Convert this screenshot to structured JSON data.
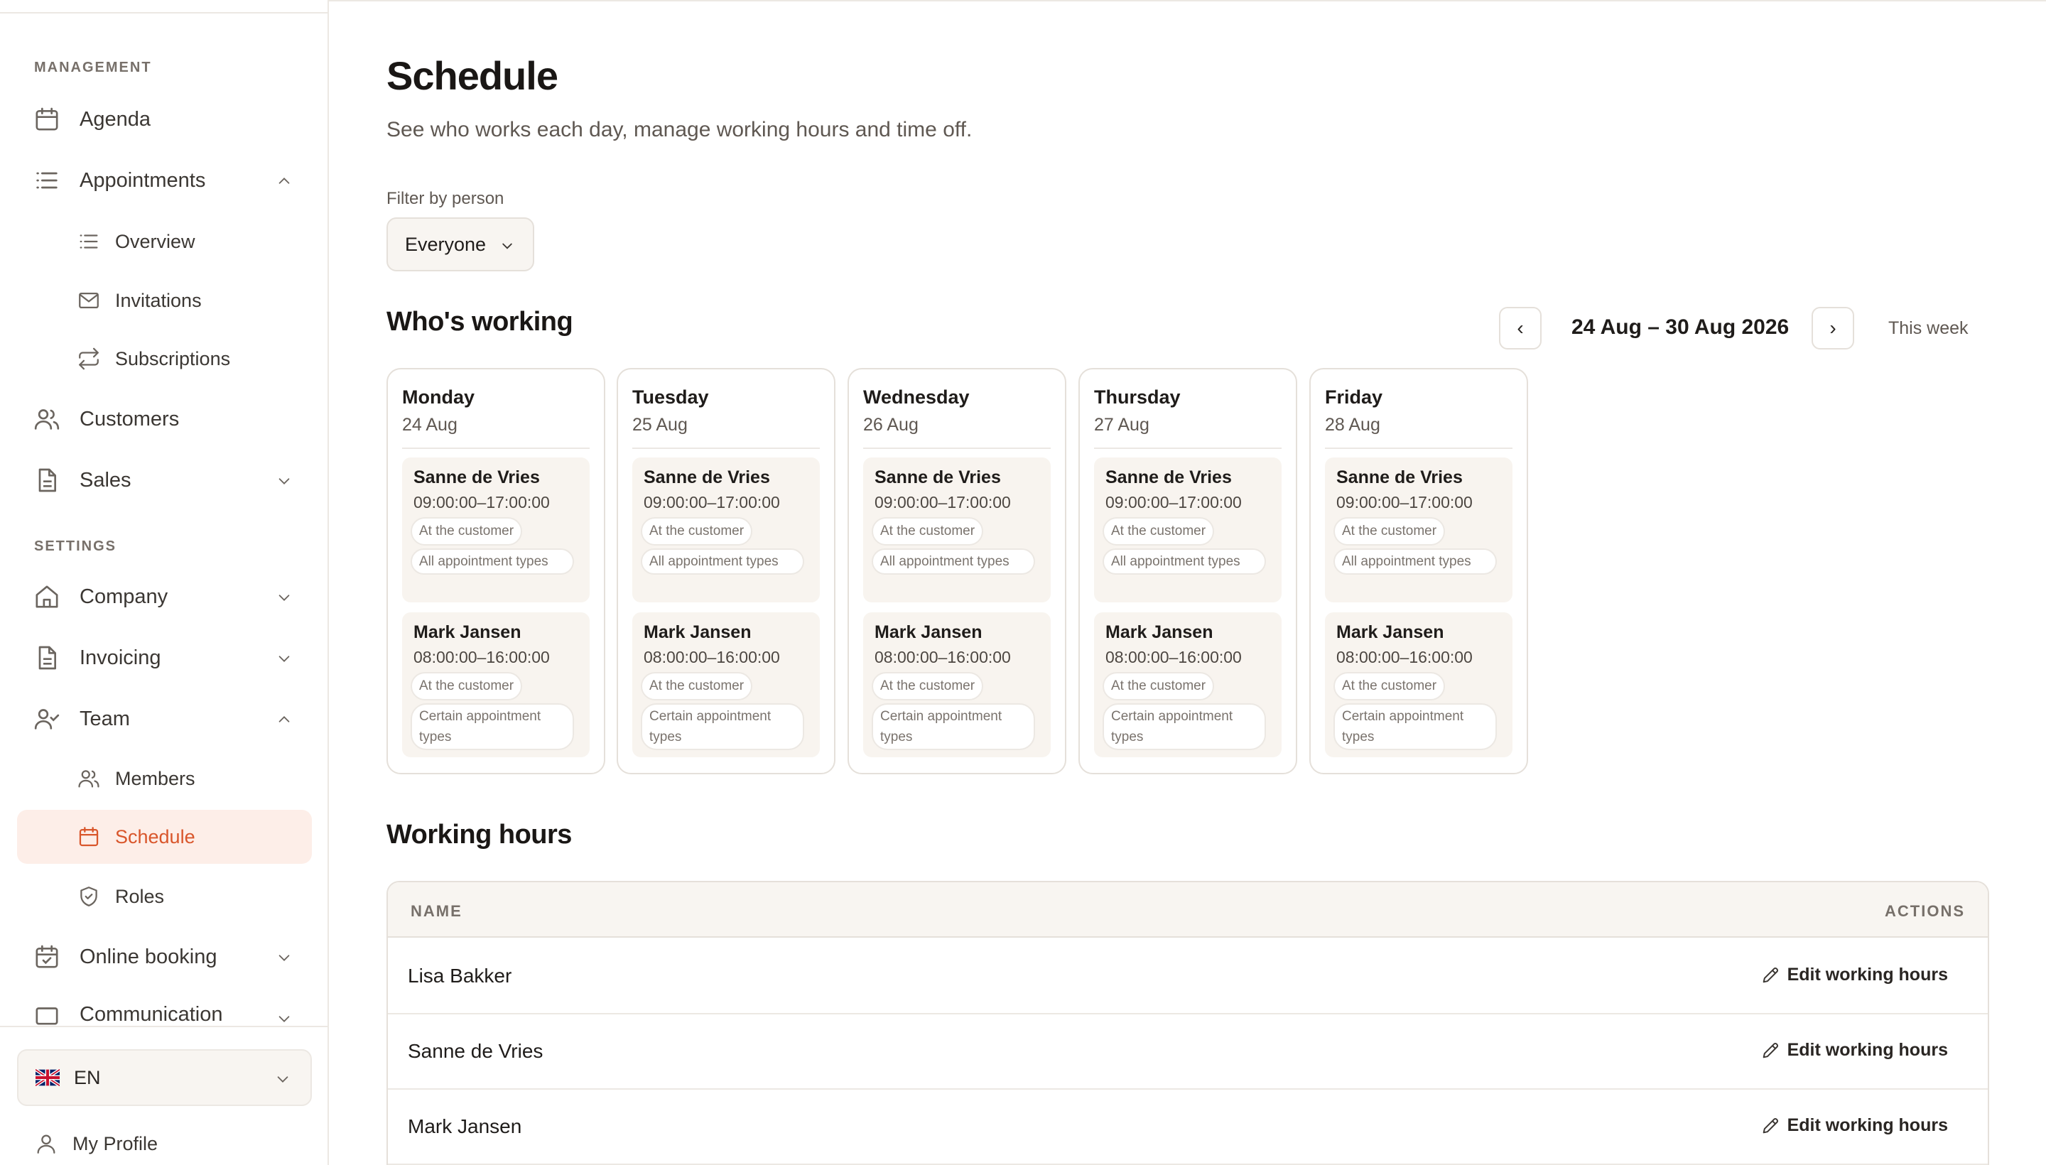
{
  "sidebar": {
    "management_label": "MANAGEMENT",
    "settings_label": "SETTINGS",
    "items": [
      {
        "label": "Agenda",
        "icon": "calendar-icon"
      },
      {
        "label": "Appointments",
        "icon": "list-icon"
      },
      {
        "label": "Overview",
        "icon": "list-icon"
      },
      {
        "label": "Invitations",
        "icon": "mail-icon"
      },
      {
        "label": "Subscriptions",
        "icon": "repeat-icon"
      },
      {
        "label": "Customers",
        "icon": "users-icon"
      },
      {
        "label": "Sales",
        "icon": "document-icon"
      },
      {
        "label": "Company",
        "icon": "home-icon"
      },
      {
        "label": "Invoicing",
        "icon": "document-icon"
      },
      {
        "label": "Team",
        "icon": "user-check-icon"
      },
      {
        "label": "Members",
        "icon": "users-icon"
      },
      {
        "label": "Schedule",
        "icon": "calendar-icon"
      },
      {
        "label": "Roles",
        "icon": "shield-icon"
      },
      {
        "label": "Online booking",
        "icon": "calendar-check-icon"
      },
      {
        "label": "Communication",
        "icon": "message-icon"
      }
    ],
    "language": "EN",
    "profile": "My Profile"
  },
  "page": {
    "title": "Schedule",
    "subtitle": "See who works each day, manage working hours and time off.",
    "filter_label": "Filter by person",
    "filter_value": "Everyone"
  },
  "whos_working": {
    "title": "Who's working",
    "prev": "‹",
    "next": "›",
    "range": "24 Aug – 30 Aug 2026",
    "this_week": "This week",
    "days": [
      {
        "name": "Monday",
        "date": "24 Aug"
      },
      {
        "name": "Tuesday",
        "date": "25 Aug"
      },
      {
        "name": "Wednesday",
        "date": "26 Aug"
      },
      {
        "name": "Thursday",
        "date": "27 Aug"
      },
      {
        "name": "Friday",
        "date": "28 Aug"
      }
    ],
    "shifts": [
      {
        "name": "Sanne de Vries",
        "time": "09:00:00–17:00:00",
        "location": "At the customer",
        "types": "All appointment types"
      },
      {
        "name": "Mark Jansen",
        "time": "08:00:00–16:00:00",
        "location": "At the customer",
        "types": "Certain appointment types"
      }
    ]
  },
  "working_hours": {
    "title": "Working hours",
    "col_name": "NAME",
    "col_actions": "ACTIONS",
    "edit_label": "Edit working hours",
    "rows": [
      {
        "name": "Lisa Bakker"
      },
      {
        "name": "Sanne de Vries"
      },
      {
        "name": "Mark Jansen"
      }
    ]
  },
  "colors": {
    "accent": "#d9562b",
    "accent_bg": "#fdeee8",
    "surface": "#f8f5f1",
    "border": "#e5e0da"
  }
}
